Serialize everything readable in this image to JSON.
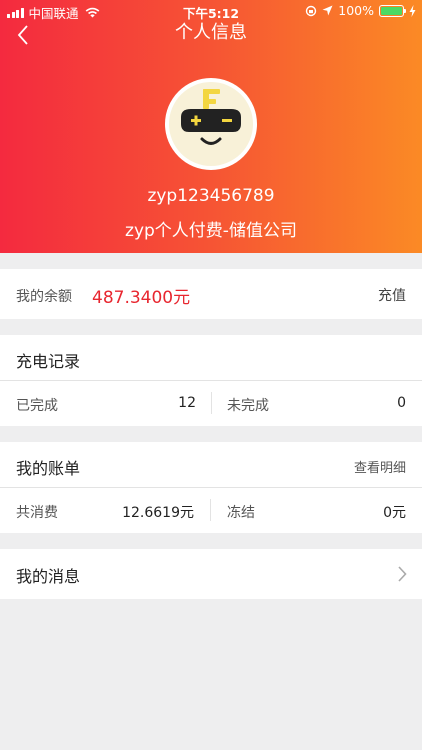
{
  "status_bar": {
    "carrier": "中国联通",
    "time": "下午5:12",
    "battery": "100%"
  },
  "nav": {
    "title": "个人信息"
  },
  "profile": {
    "username": "zyp123456789",
    "company": "zyp个人付费-储值公司"
  },
  "balance": {
    "label": "我的余额",
    "amount": "487.3400元",
    "action": "充值"
  },
  "charge_records": {
    "title": "充电记录",
    "completed_label": "已完成",
    "completed_value": "12",
    "pending_label": "未完成",
    "pending_value": "0"
  },
  "bills": {
    "title": "我的账单",
    "detail_link": "查看明细",
    "total_label": "共消费",
    "total_value": "12.6619元",
    "frozen_label": "冻结",
    "frozen_value": "0元"
  },
  "messages": {
    "title": "我的消息"
  },
  "colors": {
    "header_start": "#f42a3f",
    "header_end": "#fb8a25",
    "amount": "#e8262f",
    "background": "#eeeeef"
  }
}
